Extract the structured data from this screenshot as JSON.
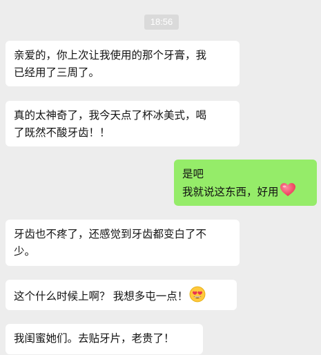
{
  "chat": {
    "timestamp": "18:56",
    "messages": [
      {
        "side": "left",
        "lines": [
          "亲爱的，你上次让我使用的那个牙膏，我",
          "已经用了三周了。"
        ]
      },
      {
        "side": "left",
        "lines": [
          "真的太神奇了，我今天点了杯冰美式，喝",
          "了既然不酸牙齿！！"
        ]
      },
      {
        "side": "right",
        "lines": [
          "是吧",
          "我就说这东西，好用"
        ],
        "emoji": "heart-emoji"
      },
      {
        "side": "left",
        "lines": [
          "牙齿也不疼了，还感觉到牙齿都变白了不",
          "少。"
        ]
      },
      {
        "side": "left",
        "lines": [
          "这个什么时候上啊？ 我想多屯一点！"
        ],
        "emoji": "heart-eyes-emoji"
      },
      {
        "side": "left",
        "lines": [
          "我闺蜜她们。去贴牙片，老贵了！"
        ]
      }
    ]
  },
  "colors": {
    "background": "#ededed",
    "left_bubble": "#ffffff",
    "right_bubble": "#95ec69",
    "timestamp_bg": "#dadada"
  }
}
